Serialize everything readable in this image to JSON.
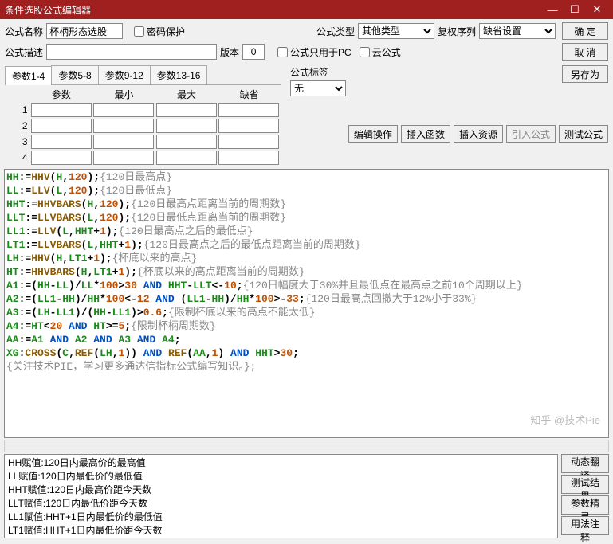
{
  "titlebar": {
    "title": "条件选股公式编辑器"
  },
  "labels": {
    "formula_name": "公式名称",
    "password": "密码保护",
    "formula_type": "公式类型",
    "restore_seq": "复权序列",
    "formula_desc": "公式描述",
    "version": "版本",
    "pc_only": "公式只用于PC",
    "cloud": "云公式",
    "formula_tag": "公式标签",
    "param_hdr": "参数",
    "min_hdr": "最小",
    "max_hdr": "最大",
    "def_hdr": "缺省"
  },
  "fields": {
    "formula_name": "杯柄形态选股",
    "formula_desc": "",
    "version": "0",
    "formula_type": "其他类型",
    "restore_seq": "缺省设置",
    "formula_tag": "无"
  },
  "buttons": {
    "ok": "确 定",
    "cancel": "取 消",
    "saveas": "另存为",
    "edit_op": "编辑操作",
    "ins_func": "插入函数",
    "ins_res": "插入资源",
    "import_f": "引入公式",
    "test_f": "测试公式",
    "dyn_trans": "动态翻译",
    "test_res": "测试结果",
    "param_wiz": "参数精灵",
    "usage": "用法注释"
  },
  "param_tabs": [
    "参数1-4",
    "参数5-8",
    "参数9-12",
    "参数13-16"
  ],
  "param_rows": [
    "1",
    "2",
    "3",
    "4"
  ],
  "code_lines": [
    {
      "r": [
        [
          "var",
          "HH"
        ],
        [
          "op",
          ":="
        ],
        [
          "func",
          "HHV"
        ],
        [
          "op",
          "("
        ],
        [
          "var",
          "H"
        ],
        [
          "op",
          ","
        ],
        [
          "num",
          "120"
        ],
        [
          "op",
          ");"
        ],
        [
          "cmt",
          "{120日最高点}"
        ]
      ]
    },
    {
      "r": [
        [
          "var",
          "LL"
        ],
        [
          "op",
          ":="
        ],
        [
          "func",
          "LLV"
        ],
        [
          "op",
          "("
        ],
        [
          "var",
          "L"
        ],
        [
          "op",
          ","
        ],
        [
          "num",
          "120"
        ],
        [
          "op",
          ");"
        ],
        [
          "cmt",
          "{120日最低点}"
        ]
      ]
    },
    {
      "r": [
        [
          "var",
          "HHT"
        ],
        [
          "op",
          ":="
        ],
        [
          "func",
          "HHVBARS"
        ],
        [
          "op",
          "("
        ],
        [
          "var",
          "H"
        ],
        [
          "op",
          ","
        ],
        [
          "num",
          "120"
        ],
        [
          "op",
          ");"
        ],
        [
          "cmt",
          "{120日最高点距离当前的周期数}"
        ]
      ]
    },
    {
      "r": [
        [
          "var",
          "LLT"
        ],
        [
          "op",
          ":="
        ],
        [
          "func",
          "LLVBARS"
        ],
        [
          "op",
          "("
        ],
        [
          "var",
          "L"
        ],
        [
          "op",
          ","
        ],
        [
          "num",
          "120"
        ],
        [
          "op",
          ");"
        ],
        [
          "cmt",
          "{120日最低点距离当前的周期数}"
        ]
      ]
    },
    {
      "r": [
        [
          "var",
          "LL1"
        ],
        [
          "op",
          ":="
        ],
        [
          "func",
          "LLV"
        ],
        [
          "op",
          "("
        ],
        [
          "var",
          "L"
        ],
        [
          "op",
          ","
        ],
        [
          "var",
          "HHT"
        ],
        [
          "op",
          "+"
        ],
        [
          "num",
          "1"
        ],
        [
          "op",
          ");"
        ],
        [
          "cmt",
          "{120日最高点之后的最低点}"
        ]
      ]
    },
    {
      "r": [
        [
          "var",
          "LT1"
        ],
        [
          "op",
          ":="
        ],
        [
          "func",
          "LLVBARS"
        ],
        [
          "op",
          "("
        ],
        [
          "var",
          "L"
        ],
        [
          "op",
          ","
        ],
        [
          "var",
          "HHT"
        ],
        [
          "op",
          "+"
        ],
        [
          "num",
          "1"
        ],
        [
          "op",
          ");"
        ],
        [
          "cmt",
          "{120日最高点之后的最低点距离当前的周期数}"
        ]
      ]
    },
    {
      "r": [
        [
          "var",
          "LH"
        ],
        [
          "op",
          ":="
        ],
        [
          "func",
          "HHV"
        ],
        [
          "op",
          "("
        ],
        [
          "var",
          "H"
        ],
        [
          "op",
          ","
        ],
        [
          "var",
          "LT1"
        ],
        [
          "op",
          "+"
        ],
        [
          "num",
          "1"
        ],
        [
          "op",
          ");"
        ],
        [
          "cmt",
          "{杯底以来的高点}"
        ]
      ]
    },
    {
      "r": [
        [
          "var",
          "HT"
        ],
        [
          "op",
          ":="
        ],
        [
          "func",
          "HHVBARS"
        ],
        [
          "op",
          "("
        ],
        [
          "var",
          "H"
        ],
        [
          "op",
          ","
        ],
        [
          "var",
          "LT1"
        ],
        [
          "op",
          "+"
        ],
        [
          "num",
          "1"
        ],
        [
          "op",
          ");"
        ],
        [
          "cmt",
          "{杯底以来的高点距离当前的周期数}"
        ]
      ]
    },
    {
      "r": [
        [
          "var",
          "A1"
        ],
        [
          "op",
          ":=("
        ],
        [
          "var",
          "HH"
        ],
        [
          "op",
          "-"
        ],
        [
          "var",
          "LL"
        ],
        [
          "op",
          ")/"
        ],
        [
          "var",
          "LL"
        ],
        [
          "op",
          "*"
        ],
        [
          "num",
          "100"
        ],
        [
          "op",
          ">"
        ],
        [
          "num",
          "30"
        ],
        [
          "blue",
          " AND "
        ],
        [
          "var",
          "HHT"
        ],
        [
          "op",
          "-"
        ],
        [
          "var",
          "LLT"
        ],
        [
          "op",
          "<-"
        ],
        [
          "num",
          "10"
        ],
        [
          "op",
          ";"
        ],
        [
          "cmt",
          "{120日幅度大于30%并且最低点在最高点之前10个周期以上}"
        ]
      ]
    },
    {
      "r": [
        [
          "var",
          "A2"
        ],
        [
          "op",
          ":=("
        ],
        [
          "var",
          "LL1"
        ],
        [
          "op",
          "-"
        ],
        [
          "var",
          "HH"
        ],
        [
          "op",
          ")/"
        ],
        [
          "var",
          "HH"
        ],
        [
          "op",
          "*"
        ],
        [
          "num",
          "100"
        ],
        [
          "op",
          "<-"
        ],
        [
          "num",
          "12"
        ],
        [
          "blue",
          " AND "
        ],
        [
          "op",
          "("
        ],
        [
          "var",
          "LL1"
        ],
        [
          "op",
          "-"
        ],
        [
          "var",
          "HH"
        ],
        [
          "op",
          ")/"
        ],
        [
          "var",
          "HH"
        ],
        [
          "op",
          "*"
        ],
        [
          "num",
          "100"
        ],
        [
          "op",
          ">-"
        ],
        [
          "num",
          "33"
        ],
        [
          "op",
          ";"
        ],
        [
          "cmt",
          "{120日最高点回撤大于12%小于33%}"
        ]
      ]
    },
    {
      "r": [
        [
          "var",
          "A3"
        ],
        [
          "op",
          ":=("
        ],
        [
          "var",
          "LH"
        ],
        [
          "op",
          "-"
        ],
        [
          "var",
          "LL1"
        ],
        [
          "op",
          ")/("
        ],
        [
          "var",
          "HH"
        ],
        [
          "op",
          "-"
        ],
        [
          "var",
          "LL1"
        ],
        [
          "op",
          ")>"
        ],
        [
          "num",
          "0.6"
        ],
        [
          "op",
          ";"
        ],
        [
          "cmt",
          "{限制杯底以来的高点不能太低}"
        ]
      ]
    },
    {
      "r": [
        [
          "var",
          "A4"
        ],
        [
          "op",
          ":="
        ],
        [
          "var",
          "HT"
        ],
        [
          "op",
          "<"
        ],
        [
          "num",
          "20"
        ],
        [
          "blue",
          " AND "
        ],
        [
          "var",
          "HT"
        ],
        [
          "op",
          ">="
        ],
        [
          "num",
          "5"
        ],
        [
          "op",
          ";"
        ],
        [
          "cmt",
          "{限制杯柄周期数}"
        ]
      ]
    },
    {
      "r": [
        [
          "var",
          "AA"
        ],
        [
          "op",
          ":="
        ],
        [
          "var",
          "A1"
        ],
        [
          "blue",
          " AND "
        ],
        [
          "var",
          "A2"
        ],
        [
          "blue",
          " AND "
        ],
        [
          "var",
          "A3"
        ],
        [
          "blue",
          " AND "
        ],
        [
          "var",
          "A4"
        ],
        [
          "op",
          ";"
        ]
      ]
    },
    {
      "r": [
        [
          "var",
          "XG"
        ],
        [
          "op",
          ":"
        ],
        [
          "func",
          "CROSS"
        ],
        [
          "op",
          "("
        ],
        [
          "var",
          "C"
        ],
        [
          "op",
          ","
        ],
        [
          "func",
          "REF"
        ],
        [
          "op",
          "("
        ],
        [
          "var",
          "LH"
        ],
        [
          "op",
          ","
        ],
        [
          "num",
          "1"
        ],
        [
          "op",
          "))"
        ],
        [
          "blue",
          " AND "
        ],
        [
          "func",
          "REF"
        ],
        [
          "op",
          "("
        ],
        [
          "var",
          "AA"
        ],
        [
          "op",
          ","
        ],
        [
          "num",
          "1"
        ],
        [
          "op",
          ")"
        ],
        [
          "blue",
          " AND "
        ],
        [
          "var",
          "HHT"
        ],
        [
          "op",
          ">"
        ],
        [
          "num",
          "30"
        ],
        [
          "op",
          ";"
        ]
      ]
    },
    {
      "r": [
        [
          "cmt",
          "{关注技术PIE，学习更多通达信指标公式编写知识。};"
        ]
      ]
    }
  ],
  "output_lines": [
    "HH赋值:120日内最高价的最高值",
    "LL赋值:120日内最低价的最低值",
    "HHT赋值:120日内最高价距今天数",
    "LLT赋值:120日内最低价距今天数",
    "LL1赋值:HHT+1日内最低价的最低值",
    "LT1赋值:HHT+1日内最低价距今天数"
  ],
  "watermark": "知乎 @技术Pie"
}
